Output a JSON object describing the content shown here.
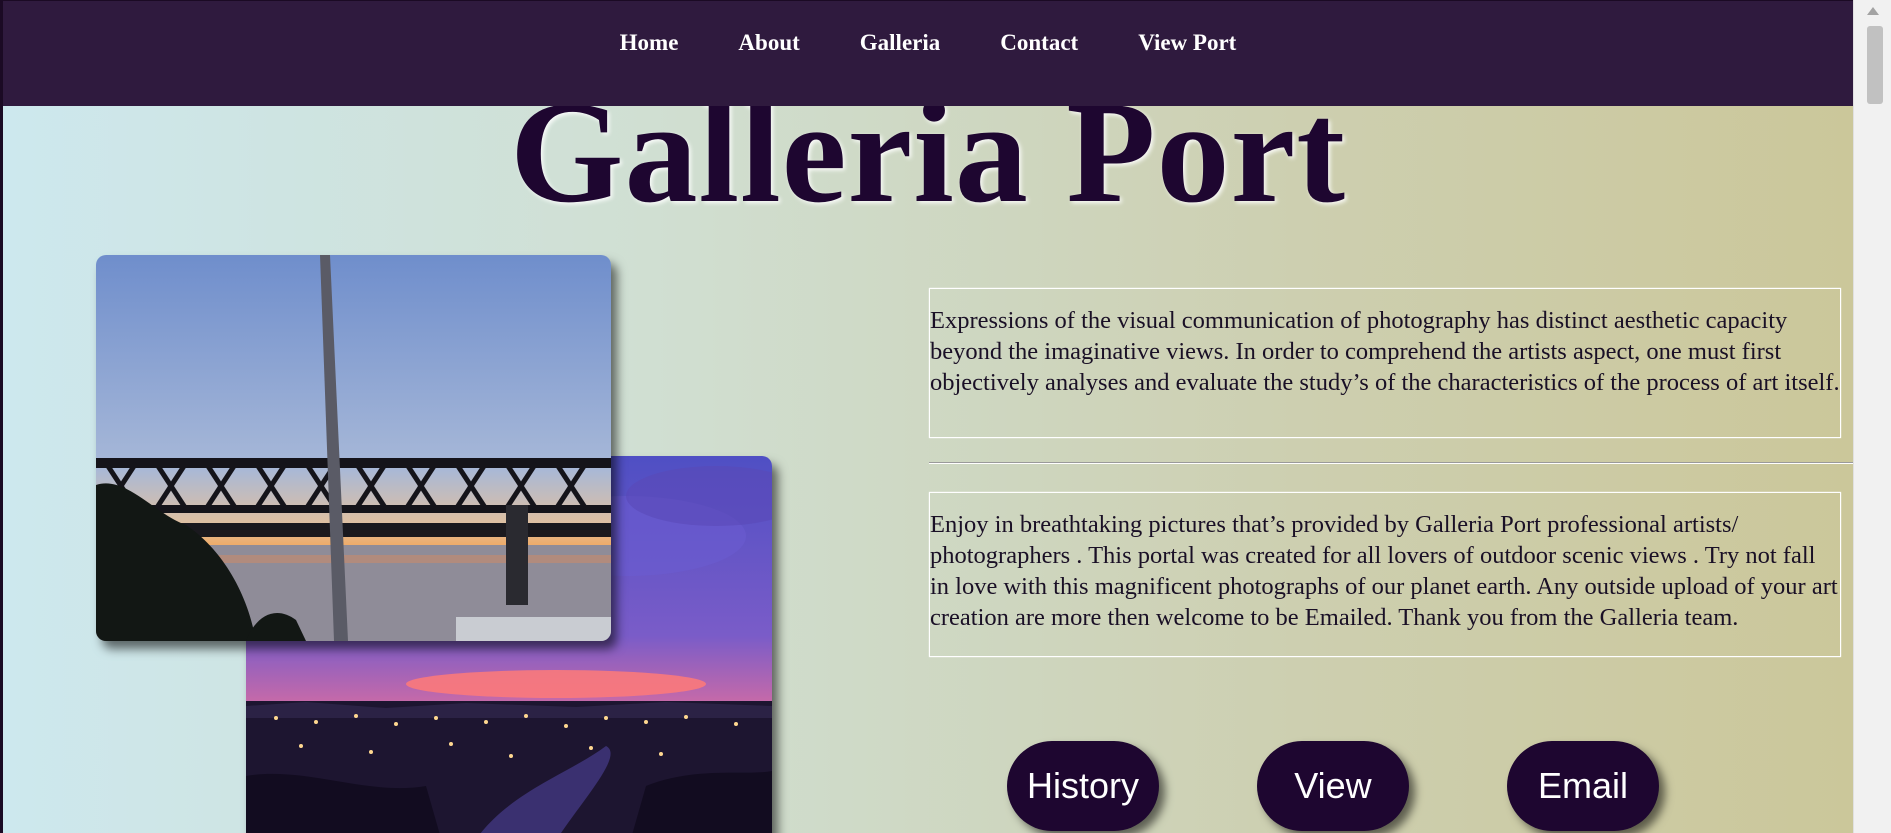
{
  "nav": {
    "items": [
      {
        "label": "Home"
      },
      {
        "label": "About"
      },
      {
        "label": "Galleria"
      },
      {
        "label": "Contact"
      },
      {
        "label": "View Port"
      }
    ]
  },
  "hero": {
    "title": "Galleria Port"
  },
  "content": {
    "paragraph1": "Expressions of the visual communication of photography has distinct aesthetic capacity beyond the imaginative views. In order to comprehend the artists aspect, one must first objectively analyses and evaluate the study’s of the characteristics of the process of art itself.",
    "paragraph2": "Enjoy in breathtaking pictures that’s provided by Galleria Port professional artists/ photographers . This portal was created for all lovers of outdoor scenic views . Try not fall in love with this magnificent photographs of our planet earth. Any outside upload of your art creation are more then welcome to be Emailed. Thank you from the Galleria team."
  },
  "buttons": {
    "history": "History",
    "view": "View",
    "email": "Email"
  },
  "colors": {
    "nav_bg": "#2f1a3e",
    "title": "#1e0630",
    "button_bg": "#1e0630"
  }
}
